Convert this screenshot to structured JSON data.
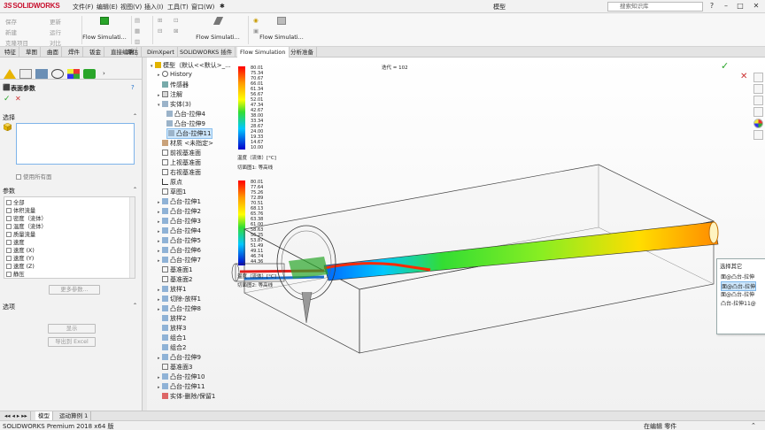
{
  "app": {
    "logo_ds": "3S",
    "logo_text": "SOLIDWORKS",
    "document_title": "模型",
    "search_placeholder": "搜索知识库"
  },
  "menu": [
    "文件(F)",
    "编辑(E)",
    "视图(V)",
    "插入(I)",
    "工具(T)",
    "窗口(W)"
  ],
  "ribbon": {
    "small_left": [
      "保存",
      "新建",
      "克隆项目"
    ],
    "small_mid": [
      "更新",
      "运行",
      "对比"
    ],
    "flow_sim_label": "Flow Simulati..."
  },
  "tabs": [
    "特征",
    "草图",
    "曲面",
    "焊件",
    "钣金",
    "直接编辑",
    "评估",
    "DimXpert",
    "SOLIDWORKS 插件",
    "Flow Simulation",
    "分析准备"
  ],
  "active_tab": "Flow Simulation",
  "left_panel": {
    "title": "表面参数",
    "selection_header": "选择",
    "use_all_faces": "使用所有面",
    "parameters_header": "参数",
    "parameters": [
      "全部",
      "体积流量",
      "密度（流体）",
      "温度（流体）",
      "质量流量",
      "速度",
      "速度 (X)",
      "速度 (Y)",
      "速度 (Z)",
      "静压"
    ],
    "more_params_btn": "更多参数...",
    "options_header": "选项",
    "show_btn": "显示",
    "export_btn": "导出到 Excel"
  },
  "tree": {
    "root": "模型（默认<<默认>_...",
    "items": [
      "History",
      "传感器",
      "注解",
      "实体(3)",
      "凸台-拉伸4",
      "凸台-拉伸9",
      "凸台-拉伸11",
      "材质 <未指定>",
      "前视基准面",
      "上视基准面",
      "右视基准面",
      "原点",
      "草图1",
      "凸台-拉伸1",
      "凸台-拉伸2",
      "凸台-拉伸3",
      "凸台-拉伸4",
      "凸台-拉伸5",
      "凸台-拉伸6",
      "凸台-拉伸7",
      "基准面1",
      "基准面2",
      "放样1",
      "切除-放样1",
      "凸台-拉伸8",
      "放样2",
      "放样3",
      "组合1",
      "组合2",
      "凸台-拉伸9",
      "基准面3",
      "凸台-拉伸10",
      "凸台-拉伸11",
      "实体-删除/保留1"
    ]
  },
  "legend_top": {
    "values": [
      "80.01",
      "75.34",
      "70.67",
      "66.01",
      "61.34",
      "56.67",
      "52.01",
      "47.34",
      "42.67",
      "38.00",
      "33.34",
      "28.67",
      "24.00",
      "19.33",
      "14.67",
      "10.00"
    ],
    "caption1": "温度（流体）[°C]",
    "caption2": "切面图1: 等高线"
  },
  "legend_bottom": {
    "values": [
      "80.01",
      "77.64",
      "75.26",
      "72.89",
      "70.51",
      "68.13",
      "65.76",
      "63.38",
      "61.00",
      "58.63",
      "56.25",
      "53.87",
      "51.49",
      "49.11",
      "46.74",
      "44.36"
    ],
    "caption1": "温度（流体）[°C]",
    "caption2": "切面图2: 等高线"
  },
  "iteration_label": "迭代 = 102",
  "popup": {
    "title": "选择其它",
    "items": [
      "面@凸台-拉伸",
      "面@凸台-拉伸",
      "面@凸台-拉伸",
      "凸台-拉伸11@"
    ]
  },
  "bottom_tabs": [
    "模型",
    "运动算例 1"
  ],
  "status": {
    "left": "SOLIDWORKS Premium 2018 x64 版",
    "right": "在编辑 零件"
  },
  "colors": {
    "accent_blue": "#1e6fc9",
    "brand_red": "#c8102e",
    "flow_green": "#2aa52a"
  }
}
